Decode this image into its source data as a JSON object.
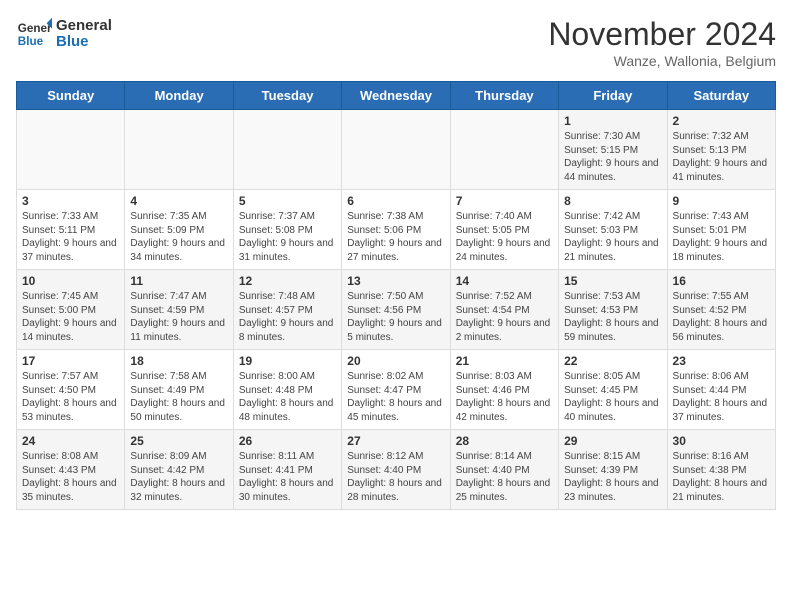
{
  "logo": {
    "line1": "General",
    "line2": "Blue"
  },
  "title": "November 2024",
  "location": "Wanze, Wallonia, Belgium",
  "days_of_week": [
    "Sunday",
    "Monday",
    "Tuesday",
    "Wednesday",
    "Thursday",
    "Friday",
    "Saturday"
  ],
  "weeks": [
    [
      {
        "day": "",
        "info": ""
      },
      {
        "day": "",
        "info": ""
      },
      {
        "day": "",
        "info": ""
      },
      {
        "day": "",
        "info": ""
      },
      {
        "day": "",
        "info": ""
      },
      {
        "day": "1",
        "info": "Sunrise: 7:30 AM\nSunset: 5:15 PM\nDaylight: 9 hours and 44 minutes."
      },
      {
        "day": "2",
        "info": "Sunrise: 7:32 AM\nSunset: 5:13 PM\nDaylight: 9 hours and 41 minutes."
      }
    ],
    [
      {
        "day": "3",
        "info": "Sunrise: 7:33 AM\nSunset: 5:11 PM\nDaylight: 9 hours and 37 minutes."
      },
      {
        "day": "4",
        "info": "Sunrise: 7:35 AM\nSunset: 5:09 PM\nDaylight: 9 hours and 34 minutes."
      },
      {
        "day": "5",
        "info": "Sunrise: 7:37 AM\nSunset: 5:08 PM\nDaylight: 9 hours and 31 minutes."
      },
      {
        "day": "6",
        "info": "Sunrise: 7:38 AM\nSunset: 5:06 PM\nDaylight: 9 hours and 27 minutes."
      },
      {
        "day": "7",
        "info": "Sunrise: 7:40 AM\nSunset: 5:05 PM\nDaylight: 9 hours and 24 minutes."
      },
      {
        "day": "8",
        "info": "Sunrise: 7:42 AM\nSunset: 5:03 PM\nDaylight: 9 hours and 21 minutes."
      },
      {
        "day": "9",
        "info": "Sunrise: 7:43 AM\nSunset: 5:01 PM\nDaylight: 9 hours and 18 minutes."
      }
    ],
    [
      {
        "day": "10",
        "info": "Sunrise: 7:45 AM\nSunset: 5:00 PM\nDaylight: 9 hours and 14 minutes."
      },
      {
        "day": "11",
        "info": "Sunrise: 7:47 AM\nSunset: 4:59 PM\nDaylight: 9 hours and 11 minutes."
      },
      {
        "day": "12",
        "info": "Sunrise: 7:48 AM\nSunset: 4:57 PM\nDaylight: 9 hours and 8 minutes."
      },
      {
        "day": "13",
        "info": "Sunrise: 7:50 AM\nSunset: 4:56 PM\nDaylight: 9 hours and 5 minutes."
      },
      {
        "day": "14",
        "info": "Sunrise: 7:52 AM\nSunset: 4:54 PM\nDaylight: 9 hours and 2 minutes."
      },
      {
        "day": "15",
        "info": "Sunrise: 7:53 AM\nSunset: 4:53 PM\nDaylight: 8 hours and 59 minutes."
      },
      {
        "day": "16",
        "info": "Sunrise: 7:55 AM\nSunset: 4:52 PM\nDaylight: 8 hours and 56 minutes."
      }
    ],
    [
      {
        "day": "17",
        "info": "Sunrise: 7:57 AM\nSunset: 4:50 PM\nDaylight: 8 hours and 53 minutes."
      },
      {
        "day": "18",
        "info": "Sunrise: 7:58 AM\nSunset: 4:49 PM\nDaylight: 8 hours and 50 minutes."
      },
      {
        "day": "19",
        "info": "Sunrise: 8:00 AM\nSunset: 4:48 PM\nDaylight: 8 hours and 48 minutes."
      },
      {
        "day": "20",
        "info": "Sunrise: 8:02 AM\nSunset: 4:47 PM\nDaylight: 8 hours and 45 minutes."
      },
      {
        "day": "21",
        "info": "Sunrise: 8:03 AM\nSunset: 4:46 PM\nDaylight: 8 hours and 42 minutes."
      },
      {
        "day": "22",
        "info": "Sunrise: 8:05 AM\nSunset: 4:45 PM\nDaylight: 8 hours and 40 minutes."
      },
      {
        "day": "23",
        "info": "Sunrise: 8:06 AM\nSunset: 4:44 PM\nDaylight: 8 hours and 37 minutes."
      }
    ],
    [
      {
        "day": "24",
        "info": "Sunrise: 8:08 AM\nSunset: 4:43 PM\nDaylight: 8 hours and 35 minutes."
      },
      {
        "day": "25",
        "info": "Sunrise: 8:09 AM\nSunset: 4:42 PM\nDaylight: 8 hours and 32 minutes."
      },
      {
        "day": "26",
        "info": "Sunrise: 8:11 AM\nSunset: 4:41 PM\nDaylight: 8 hours and 30 minutes."
      },
      {
        "day": "27",
        "info": "Sunrise: 8:12 AM\nSunset: 4:40 PM\nDaylight: 8 hours and 28 minutes."
      },
      {
        "day": "28",
        "info": "Sunrise: 8:14 AM\nSunset: 4:40 PM\nDaylight: 8 hours and 25 minutes."
      },
      {
        "day": "29",
        "info": "Sunrise: 8:15 AM\nSunset: 4:39 PM\nDaylight: 8 hours and 23 minutes."
      },
      {
        "day": "30",
        "info": "Sunrise: 8:16 AM\nSunset: 4:38 PM\nDaylight: 8 hours and 21 minutes."
      }
    ]
  ]
}
